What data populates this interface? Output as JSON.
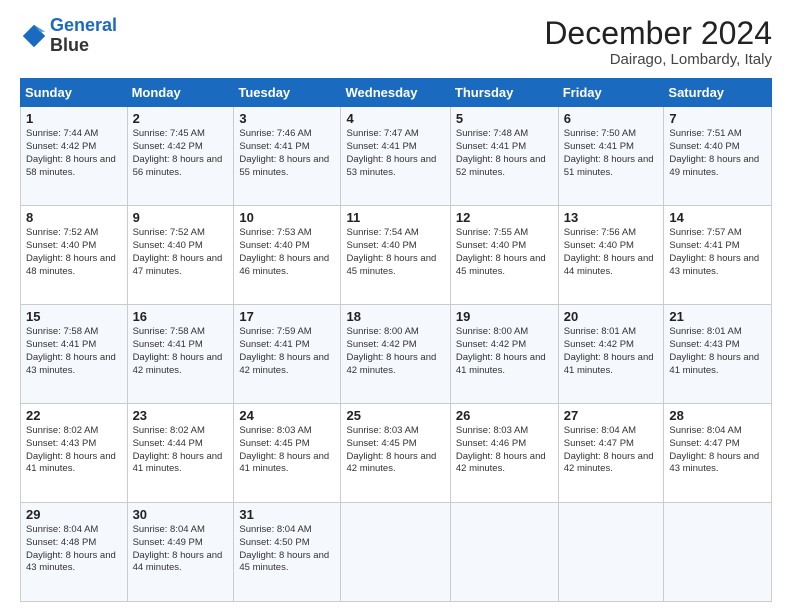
{
  "header": {
    "logo_line1": "General",
    "logo_line2": "Blue",
    "month": "December 2024",
    "location": "Dairago, Lombardy, Italy"
  },
  "columns": [
    "Sunday",
    "Monday",
    "Tuesday",
    "Wednesday",
    "Thursday",
    "Friday",
    "Saturday"
  ],
  "weeks": [
    [
      {
        "day": "1",
        "sunrise": "7:44 AM",
        "sunset": "4:42 PM",
        "daylight": "8 hours and 58 minutes."
      },
      {
        "day": "2",
        "sunrise": "7:45 AM",
        "sunset": "4:42 PM",
        "daylight": "8 hours and 56 minutes."
      },
      {
        "day": "3",
        "sunrise": "7:46 AM",
        "sunset": "4:41 PM",
        "daylight": "8 hours and 55 minutes."
      },
      {
        "day": "4",
        "sunrise": "7:47 AM",
        "sunset": "4:41 PM",
        "daylight": "8 hours and 53 minutes."
      },
      {
        "day": "5",
        "sunrise": "7:48 AM",
        "sunset": "4:41 PM",
        "daylight": "8 hours and 52 minutes."
      },
      {
        "day": "6",
        "sunrise": "7:50 AM",
        "sunset": "4:41 PM",
        "daylight": "8 hours and 51 minutes."
      },
      {
        "day": "7",
        "sunrise": "7:51 AM",
        "sunset": "4:40 PM",
        "daylight": "8 hours and 49 minutes."
      }
    ],
    [
      {
        "day": "8",
        "sunrise": "7:52 AM",
        "sunset": "4:40 PM",
        "daylight": "8 hours and 48 minutes."
      },
      {
        "day": "9",
        "sunrise": "7:52 AM",
        "sunset": "4:40 PM",
        "daylight": "8 hours and 47 minutes."
      },
      {
        "day": "10",
        "sunrise": "7:53 AM",
        "sunset": "4:40 PM",
        "daylight": "8 hours and 46 minutes."
      },
      {
        "day": "11",
        "sunrise": "7:54 AM",
        "sunset": "4:40 PM",
        "daylight": "8 hours and 45 minutes."
      },
      {
        "day": "12",
        "sunrise": "7:55 AM",
        "sunset": "4:40 PM",
        "daylight": "8 hours and 45 minutes."
      },
      {
        "day": "13",
        "sunrise": "7:56 AM",
        "sunset": "4:40 PM",
        "daylight": "8 hours and 44 minutes."
      },
      {
        "day": "14",
        "sunrise": "7:57 AM",
        "sunset": "4:41 PM",
        "daylight": "8 hours and 43 minutes."
      }
    ],
    [
      {
        "day": "15",
        "sunrise": "7:58 AM",
        "sunset": "4:41 PM",
        "daylight": "8 hours and 43 minutes."
      },
      {
        "day": "16",
        "sunrise": "7:58 AM",
        "sunset": "4:41 PM",
        "daylight": "8 hours and 42 minutes."
      },
      {
        "day": "17",
        "sunrise": "7:59 AM",
        "sunset": "4:41 PM",
        "daylight": "8 hours and 42 minutes."
      },
      {
        "day": "18",
        "sunrise": "8:00 AM",
        "sunset": "4:42 PM",
        "daylight": "8 hours and 42 minutes."
      },
      {
        "day": "19",
        "sunrise": "8:00 AM",
        "sunset": "4:42 PM",
        "daylight": "8 hours and 41 minutes."
      },
      {
        "day": "20",
        "sunrise": "8:01 AM",
        "sunset": "4:42 PM",
        "daylight": "8 hours and 41 minutes."
      },
      {
        "day": "21",
        "sunrise": "8:01 AM",
        "sunset": "4:43 PM",
        "daylight": "8 hours and 41 minutes."
      }
    ],
    [
      {
        "day": "22",
        "sunrise": "8:02 AM",
        "sunset": "4:43 PM",
        "daylight": "8 hours and 41 minutes."
      },
      {
        "day": "23",
        "sunrise": "8:02 AM",
        "sunset": "4:44 PM",
        "daylight": "8 hours and 41 minutes."
      },
      {
        "day": "24",
        "sunrise": "8:03 AM",
        "sunset": "4:45 PM",
        "daylight": "8 hours and 41 minutes."
      },
      {
        "day": "25",
        "sunrise": "8:03 AM",
        "sunset": "4:45 PM",
        "daylight": "8 hours and 42 minutes."
      },
      {
        "day": "26",
        "sunrise": "8:03 AM",
        "sunset": "4:46 PM",
        "daylight": "8 hours and 42 minutes."
      },
      {
        "day": "27",
        "sunrise": "8:04 AM",
        "sunset": "4:47 PM",
        "daylight": "8 hours and 42 minutes."
      },
      {
        "day": "28",
        "sunrise": "8:04 AM",
        "sunset": "4:47 PM",
        "daylight": "8 hours and 43 minutes."
      }
    ],
    [
      {
        "day": "29",
        "sunrise": "8:04 AM",
        "sunset": "4:48 PM",
        "daylight": "8 hours and 43 minutes."
      },
      {
        "day": "30",
        "sunrise": "8:04 AM",
        "sunset": "4:49 PM",
        "daylight": "8 hours and 44 minutes."
      },
      {
        "day": "31",
        "sunrise": "8:04 AM",
        "sunset": "4:50 PM",
        "daylight": "8 hours and 45 minutes."
      },
      null,
      null,
      null,
      null
    ]
  ]
}
